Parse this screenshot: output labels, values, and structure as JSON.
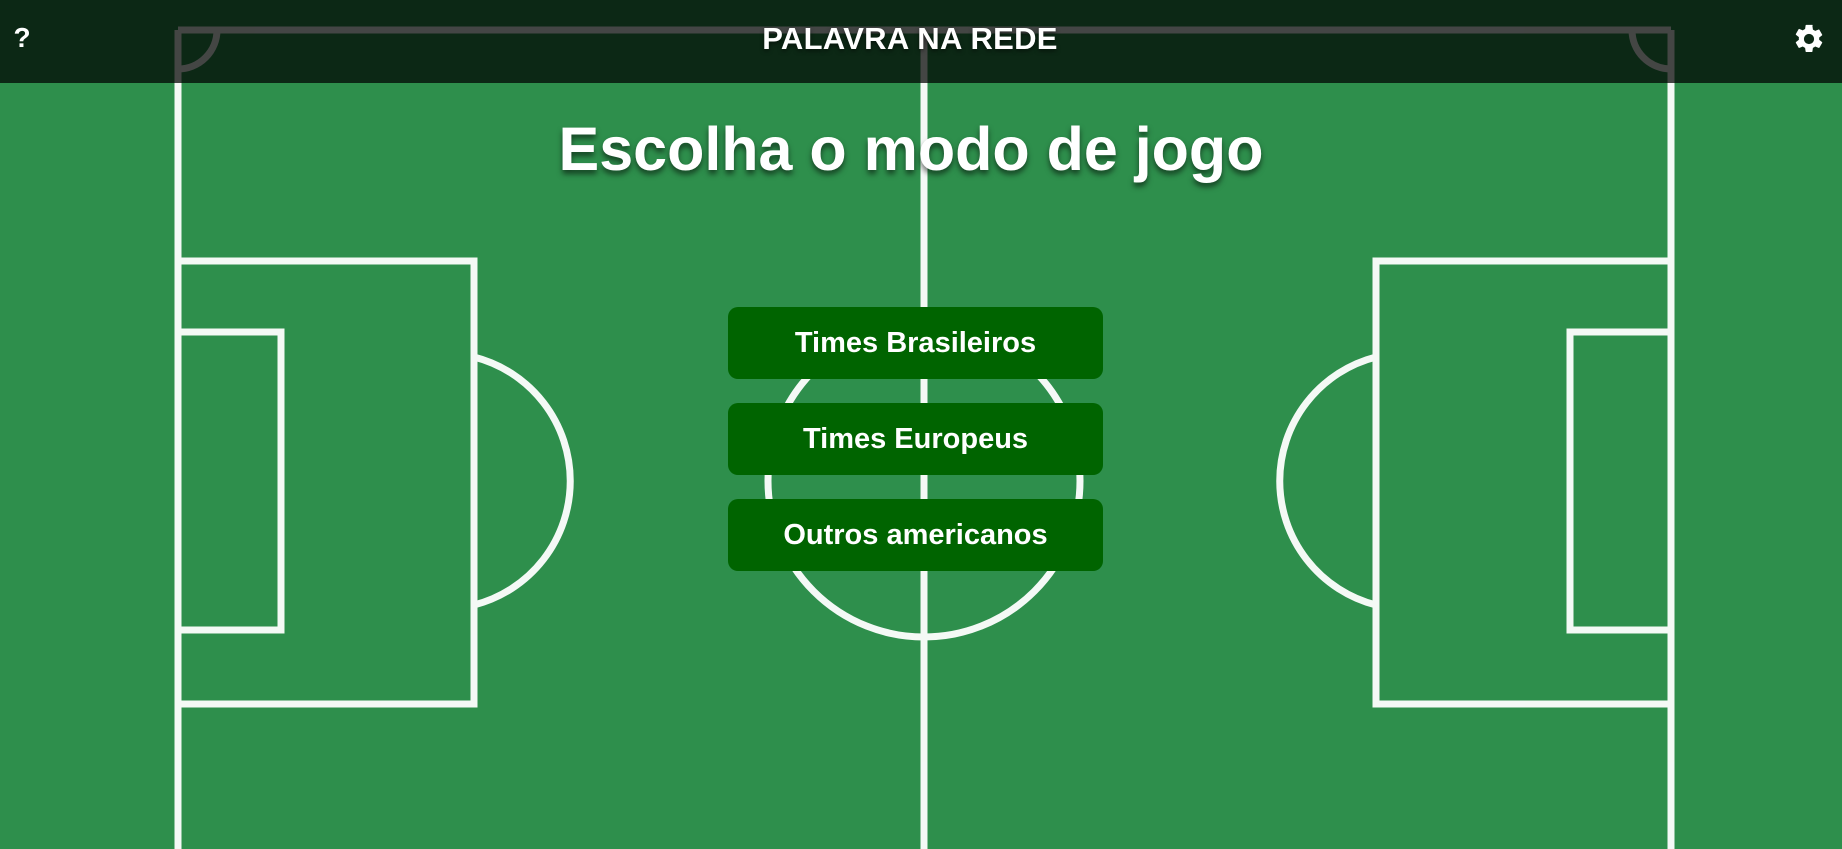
{
  "header": {
    "help_label": "?",
    "title": "PALAVRA NA REDE",
    "settings_icon": "gear-icon"
  },
  "main": {
    "title": "Escolha o modo de jogo",
    "modes": [
      {
        "label": "Times Brasileiros"
      },
      {
        "label": "Times Europeus"
      },
      {
        "label": "Outros americanos"
      }
    ]
  },
  "colors": {
    "pitch": "#2e8f4c",
    "lines": "#ffffff",
    "topbar": "#0d2418",
    "button": "#006400",
    "text": "#ffffff"
  }
}
